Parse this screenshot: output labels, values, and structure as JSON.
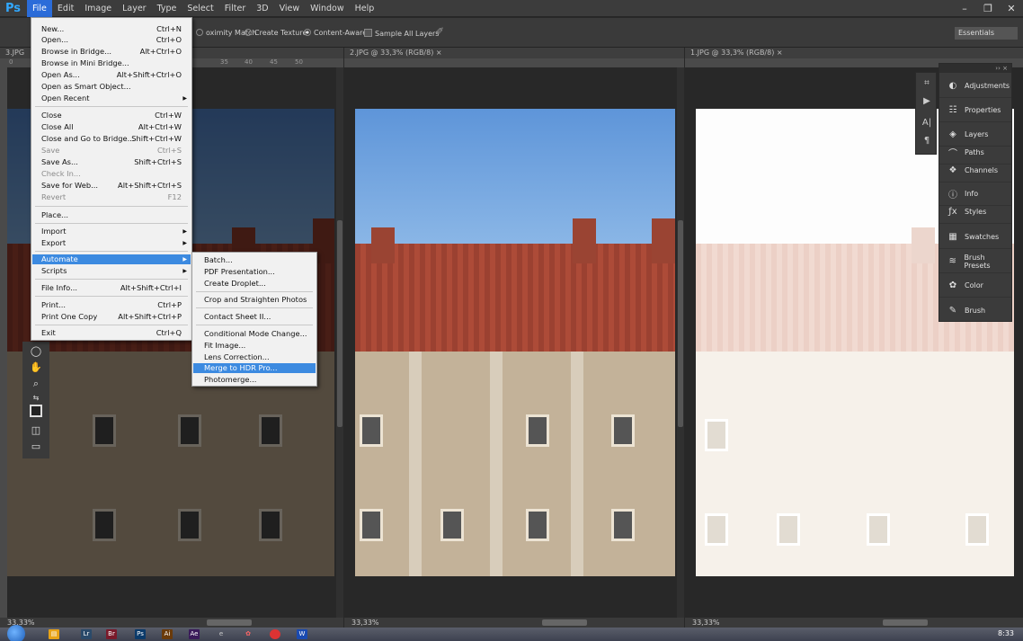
{
  "app": {
    "logo": "Ps"
  },
  "menubar": {
    "items": [
      "File",
      "Edit",
      "Image",
      "Layer",
      "Type",
      "Select",
      "Filter",
      "3D",
      "View",
      "Window",
      "Help"
    ]
  },
  "window_controls": {
    "minimize": "–",
    "restore": "❐",
    "close": "✕"
  },
  "options_bar": {
    "proximity_match": "oximity Match",
    "create_texture": "Create Texture",
    "content_aware": "Content-Aware",
    "sample_all_layers": "Sample All Layers",
    "workspace": "Essentials"
  },
  "docs": [
    {
      "tab": "3.JPG",
      "zoom": "33,33%"
    },
    {
      "tab": "2.JPG @ 33,3% (RGB/8) ×",
      "zoom": "33,33%"
    },
    {
      "tab": "1.JPG @ 33,3% (RGB/8) ×",
      "zoom": "33,33%"
    }
  ],
  "ruler_ticks": [
    "0",
    "35",
    "40",
    "45",
    "50"
  ],
  "file_menu": {
    "items": [
      {
        "label": "New...",
        "shortcut": "Ctrl+N"
      },
      {
        "label": "Open...",
        "shortcut": "Ctrl+O"
      },
      {
        "label": "Browse in Bridge...",
        "shortcut": "Alt+Ctrl+O"
      },
      {
        "label": "Browse in Mini Bridge...",
        "shortcut": ""
      },
      {
        "label": "Open As...",
        "shortcut": "Alt+Shift+Ctrl+O"
      },
      {
        "label": "Open as Smart Object...",
        "shortcut": ""
      },
      {
        "label": "Open Recent",
        "shortcut": ""
      },
      {
        "label": "Close",
        "shortcut": "Ctrl+W"
      },
      {
        "label": "Close All",
        "shortcut": "Alt+Ctrl+W"
      },
      {
        "label": "Close and Go to Bridge...",
        "shortcut": "Shift+Ctrl+W"
      },
      {
        "label": "Save",
        "shortcut": "Ctrl+S"
      },
      {
        "label": "Save As...",
        "shortcut": "Shift+Ctrl+S"
      },
      {
        "label": "Check In...",
        "shortcut": ""
      },
      {
        "label": "Save for Web...",
        "shortcut": "Alt+Shift+Ctrl+S"
      },
      {
        "label": "Revert",
        "shortcut": "F12"
      },
      {
        "label": "Place...",
        "shortcut": ""
      },
      {
        "label": "Import",
        "shortcut": ""
      },
      {
        "label": "Export",
        "shortcut": ""
      },
      {
        "label": "Automate",
        "shortcut": ""
      },
      {
        "label": "Scripts",
        "shortcut": ""
      },
      {
        "label": "File Info...",
        "shortcut": "Alt+Shift+Ctrl+I"
      },
      {
        "label": "Print...",
        "shortcut": "Ctrl+P"
      },
      {
        "label": "Print One Copy",
        "shortcut": "Alt+Shift+Ctrl+P"
      },
      {
        "label": "Exit",
        "shortcut": "Ctrl+Q"
      }
    ]
  },
  "automate_menu": {
    "items": [
      "Batch...",
      "PDF Presentation...",
      "Create Droplet...",
      "Crop and Straighten Photos",
      "Contact Sheet II...",
      "Conditional Mode Change...",
      "Fit Image...",
      "Lens Correction...",
      "Merge to HDR Pro...",
      "Photomerge..."
    ]
  },
  "panel": {
    "top": "›› ×",
    "items": [
      "Adjustments",
      "Properties",
      "Layers",
      "Paths",
      "Channels",
      "Info",
      "Styles",
      "Swatches",
      "Brush Presets",
      "Color",
      "Brush"
    ],
    "icons": [
      "adjustments-icon",
      "properties-icon",
      "layers-icon",
      "paths-icon",
      "channels-icon",
      "info-icon",
      "styles-icon",
      "swatches-icon",
      "brush-presets-icon",
      "color-icon",
      "brush-icon"
    ]
  },
  "taskbar": {
    "clock": "8:33",
    "apps": [
      "Lr",
      "Br",
      "Ps",
      "Ai",
      "Ae"
    ]
  },
  "colors": {
    "menu_highlight": "#3c8ae0",
    "ps_blue": "#31a8ff",
    "sky_normal": "#6e9fd6",
    "roof_normal": "#a5493a"
  }
}
